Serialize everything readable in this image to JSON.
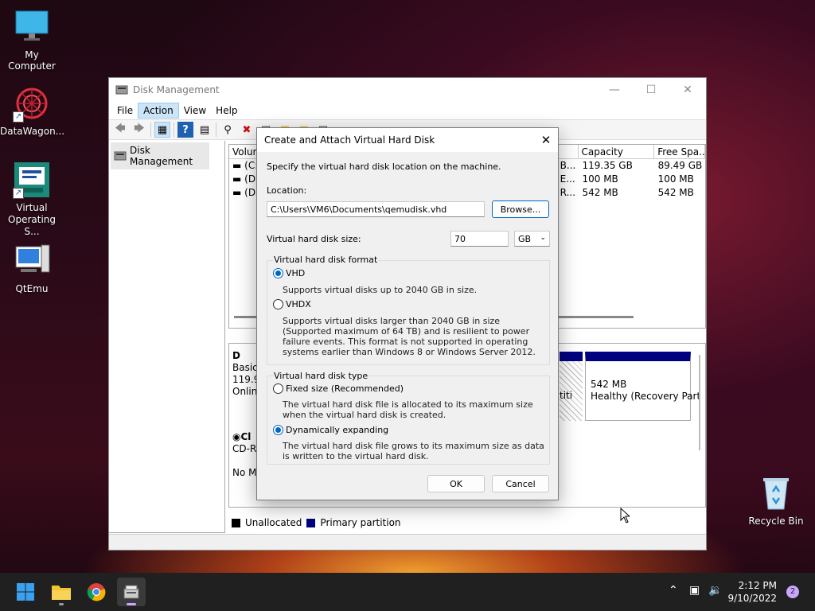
{
  "desktop": {
    "icons": [
      {
        "label": "My Computer"
      },
      {
        "label": "DataWagon..."
      },
      {
        "label": "Virtual Operating S..."
      },
      {
        "label": "QtEmu"
      },
      {
        "label": "Recycle Bin"
      }
    ]
  },
  "window": {
    "title": "Disk Management",
    "menu": {
      "file": "File",
      "action": "Action",
      "view": "View",
      "help": "Help"
    },
    "tree_root": "Disk Management",
    "volume_table": {
      "columns": [
        "Volum",
        "Capacity",
        "Free Spa..."
      ],
      "rows": [
        {
          "vol": "(C:",
          "mid": "B...",
          "capacity": "119.35 GB",
          "free": "89.49 GB"
        },
        {
          "vol": "(Di",
          "mid": "E...",
          "capacity": "100 MB",
          "free": "100 MB"
        },
        {
          "vol": "(Di",
          "mid": "R...",
          "capacity": "542 MB",
          "free": "542 MB"
        }
      ]
    },
    "disk0": {
      "name": "D",
      "type": "Basic",
      "size": "119.9",
      "status": "Onlin",
      "partition_label": "titi",
      "recovery_size": "542 MB",
      "recovery_status": "Healthy (Recovery Part"
    },
    "cdrom": {
      "name": "Cl",
      "type": "CD-R",
      "media": "No M"
    },
    "legend": {
      "unallocated": "Unallocated",
      "primary": "Primary partition",
      "unalloc_color": "#000000",
      "primary_color": "#000080"
    }
  },
  "dialog": {
    "title": "Create and Attach Virtual Hard Disk",
    "intro": "Specify the virtual hard disk location on the machine.",
    "location_label": "Location:",
    "location_value": "C:\\Users\\VM6\\Documents\\qemudisk.vhd",
    "browse_label": "Browse...",
    "size_label": "Virtual hard disk size:",
    "size_value": "70",
    "size_unit": "GB",
    "format_group": "Virtual hard disk format",
    "vhd_label": "VHD",
    "vhd_desc": "Supports virtual disks up to 2040 GB in size.",
    "vhdx_label": "VHDX",
    "vhdx_desc": "Supports virtual disks larger than 2040 GB in size (Supported maximum of 64 TB) and is resilient to power failure events. This format is not supported in operating systems earlier than Windows 8 or Windows Server 2012.",
    "type_group": "Virtual hard disk type",
    "fixed_label": "Fixed size (Recommended)",
    "fixed_desc": "The virtual hard disk file is allocated to its maximum size when the virtual hard disk is created.",
    "dynamic_label": "Dynamically expanding",
    "dynamic_desc": "The virtual hard disk file grows to its maximum size as data is written to the virtual hard disk.",
    "ok_label": "OK",
    "cancel_label": "Cancel",
    "selected_format": "VHD",
    "selected_type": "Dynamically expanding"
  },
  "taskbar": {
    "time": "2:12 PM",
    "date": "9/10/2022",
    "notifications": "2"
  }
}
